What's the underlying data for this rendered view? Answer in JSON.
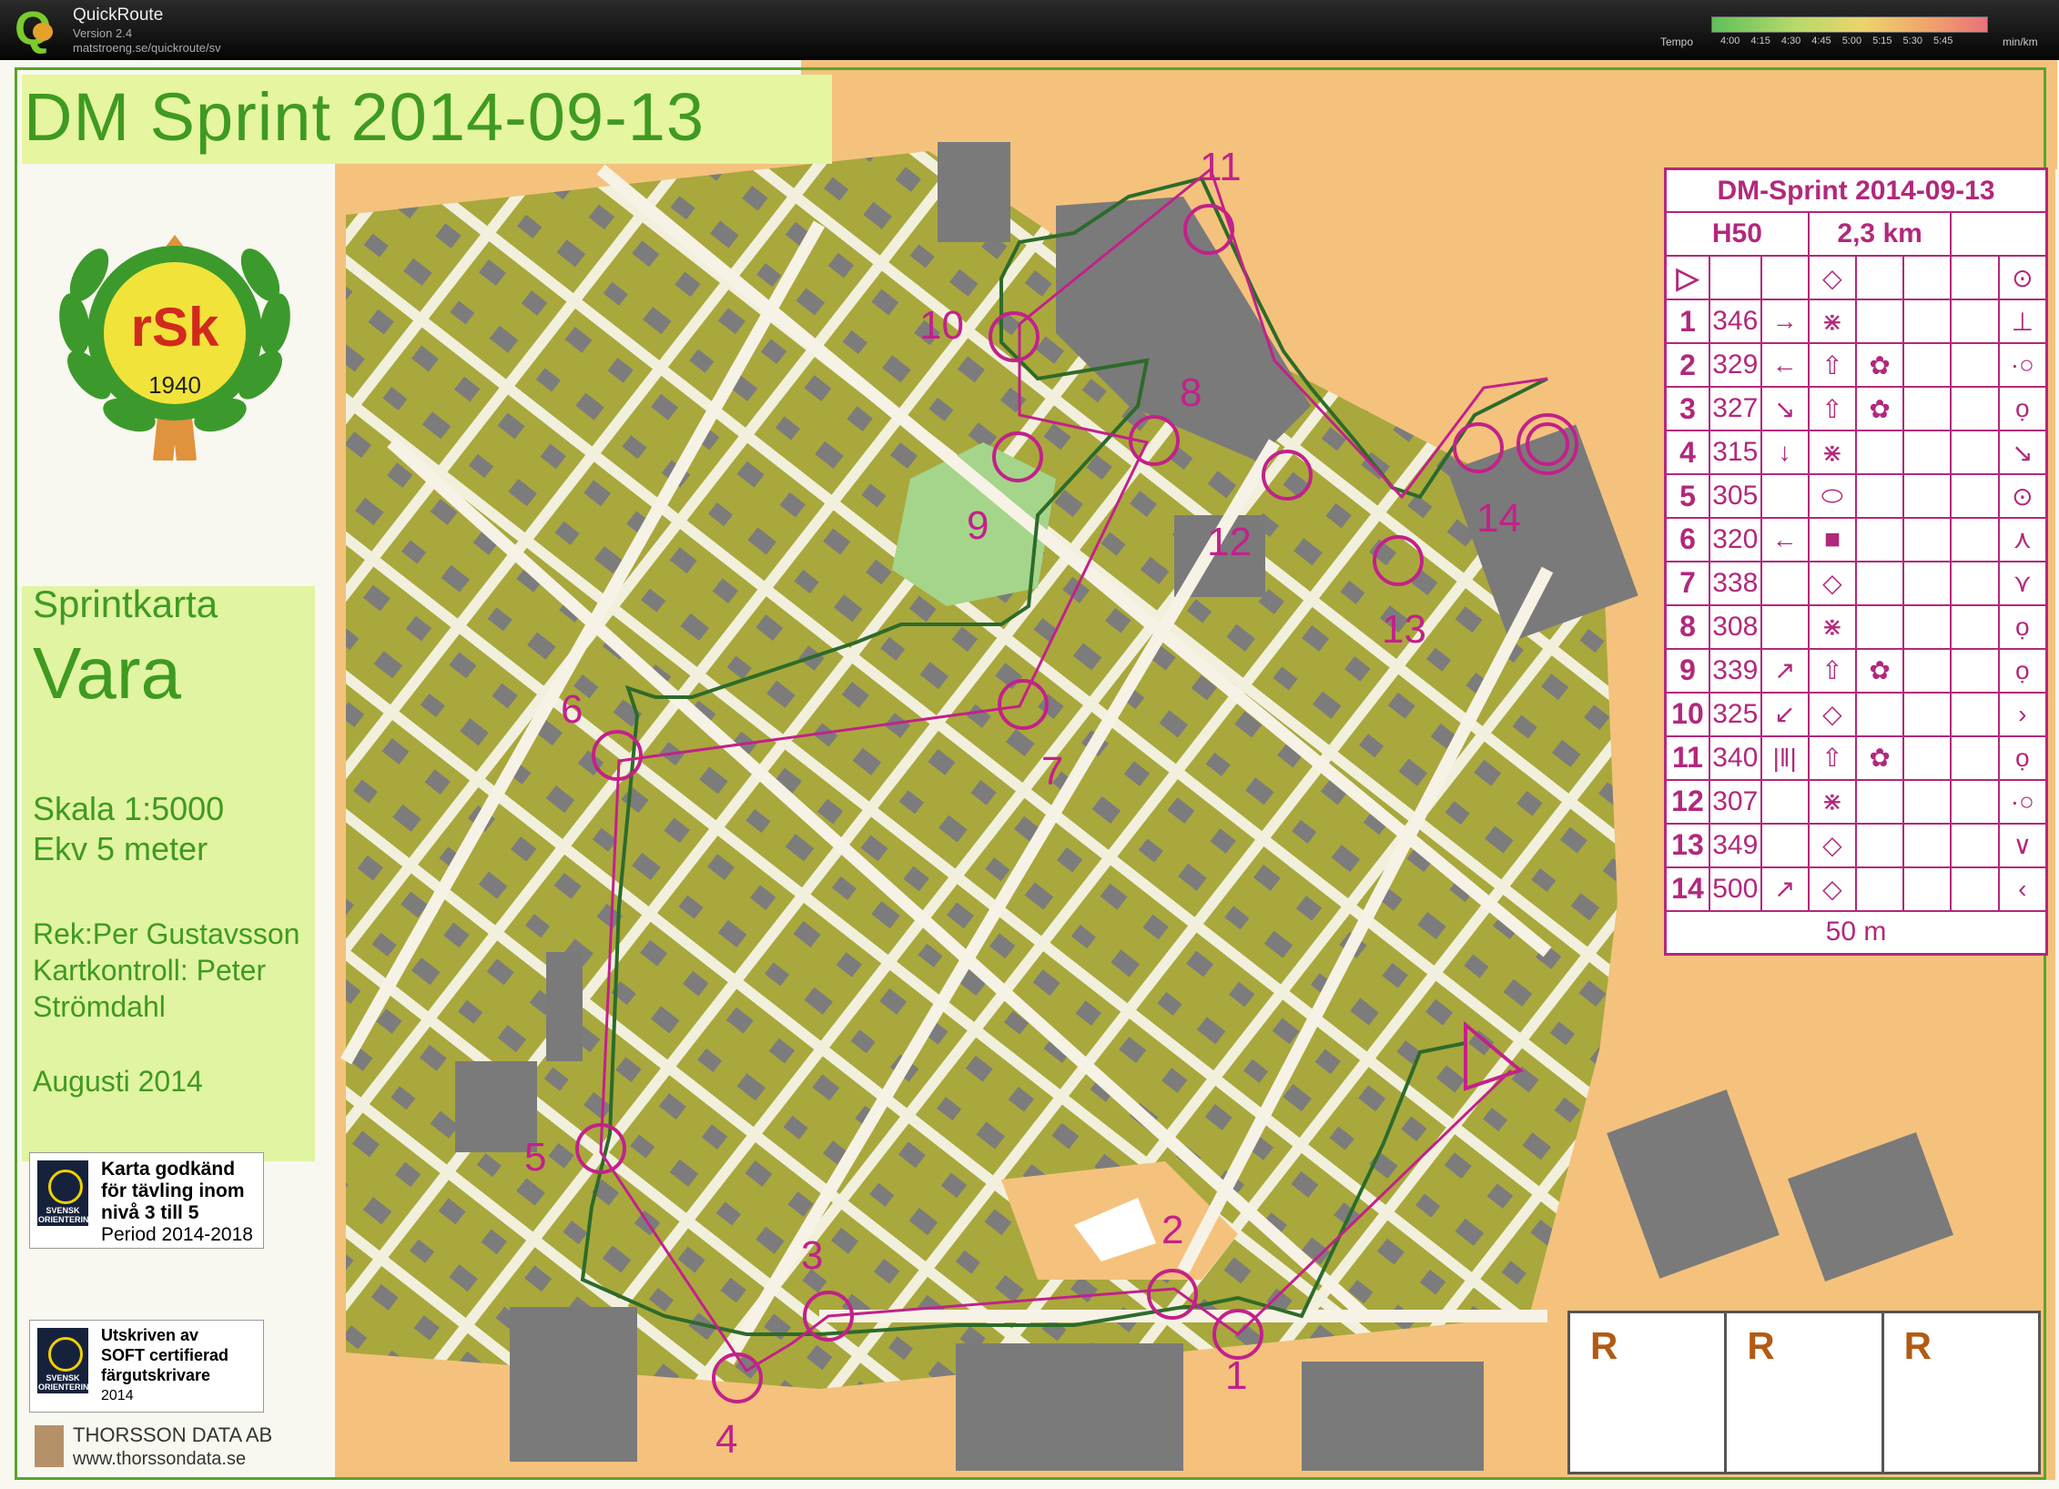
{
  "app": {
    "name": "QuickRoute",
    "version": "Version 2.4",
    "url": "matstroeng.se/quickroute/sv",
    "tempo_label": "Tempo",
    "tempo_ticks": [
      "4:00",
      "4:15",
      "4:30",
      "4:45",
      "5:00",
      "5:15",
      "5:30",
      "5:45"
    ],
    "tempo_unit": "min/km"
  },
  "map": {
    "title": "DM Sprint 2014-09-13",
    "club_logo": {
      "text": "rSk",
      "year": "1940"
    },
    "info": {
      "subtitle": "Sprintkarta",
      "place": "Vara",
      "scale": "Skala 1:5000",
      "equidistance": "Ekv 5 meter",
      "drawn_by": "Rek:Per Gustavsson",
      "map_check_1": "Kartkontroll: Peter",
      "map_check_2": "Strömdahl",
      "date": "Augusti 2014"
    },
    "badges": [
      {
        "lines": [
          "Karta godkänd",
          "för tävling inom",
          "nivå 3 till 5",
          "Period 2014-2018"
        ],
        "seal": "SVENSK ORIENTERING"
      },
      {
        "lines": [
          "Utskriven av",
          "SOFT certifierad",
          "färgutskrivare",
          "2014"
        ],
        "seal": "SVENSK ORIENTERING"
      }
    ],
    "printer": {
      "name": "THORSSON DATA AB",
      "web": "www.thorssondata.se"
    },
    "controls": [
      "1",
      "2",
      "3",
      "4",
      "5",
      "6",
      "7",
      "8",
      "9",
      "10",
      "11",
      "12",
      "13",
      "14"
    ],
    "split_boxes": [
      "R",
      "R",
      "R"
    ],
    "colors": {
      "course": "#c2218a",
      "route": "#2d6b2a",
      "frame": "#59a52a",
      "title": "#3f9a21"
    }
  },
  "control_descriptions": {
    "title": "DM-Sprint 2014-09-13",
    "class": "H50",
    "length": "2,3 km",
    "rows": [
      {
        "num": "1",
        "code": "346",
        "c": "→",
        "d": "⋇",
        "e": "",
        "f": "",
        "g": "⊥"
      },
      {
        "num": "2",
        "code": "329",
        "c": "←",
        "d": "⇧",
        "e": "✿",
        "f": "",
        "g": "·○"
      },
      {
        "num": "3",
        "code": "327",
        "c": "↘",
        "d": "⇧",
        "e": "✿",
        "f": "",
        "g": "ọ"
      },
      {
        "num": "4",
        "code": "315",
        "c": "↓",
        "d": "⋇",
        "e": "",
        "f": "",
        "g": "↘"
      },
      {
        "num": "5",
        "code": "305",
        "c": "",
        "d": "⬭",
        "e": "",
        "f": "",
        "g": "⊙"
      },
      {
        "num": "6",
        "code": "320",
        "c": "←",
        "d": "■",
        "e": "",
        "f": "",
        "g": "⋏"
      },
      {
        "num": "7",
        "code": "338",
        "c": "",
        "d": "◇",
        "e": "",
        "f": "",
        "g": "⋎"
      },
      {
        "num": "8",
        "code": "308",
        "c": "",
        "d": "⋇",
        "e": "",
        "f": "",
        "g": "ọ"
      },
      {
        "num": "9",
        "code": "339",
        "c": "↗",
        "d": "⇧",
        "e": "✿",
        "f": "",
        "g": "ọ"
      },
      {
        "num": "10",
        "code": "325",
        "c": "↙",
        "d": "◇",
        "e": "",
        "f": "",
        "g": "›"
      },
      {
        "num": "11",
        "code": "340",
        "c": "|‖|",
        "d": "⇧",
        "e": "✿",
        "f": "",
        "g": "ọ"
      },
      {
        "num": "12",
        "code": "307",
        "c": "",
        "d": "⋇",
        "e": "",
        "f": "",
        "g": "·○"
      },
      {
        "num": "13",
        "code": "349",
        "c": "",
        "d": "◇",
        "e": "",
        "f": "",
        "g": "∨"
      },
      {
        "num": "14",
        "code": "500",
        "c": "↗",
        "d": "◇",
        "e": "",
        "f": "",
        "g": "‹"
      }
    ],
    "start_row": {
      "a": "▷",
      "d": "◇",
      "g": "⊙"
    },
    "finish": "50 m"
  }
}
